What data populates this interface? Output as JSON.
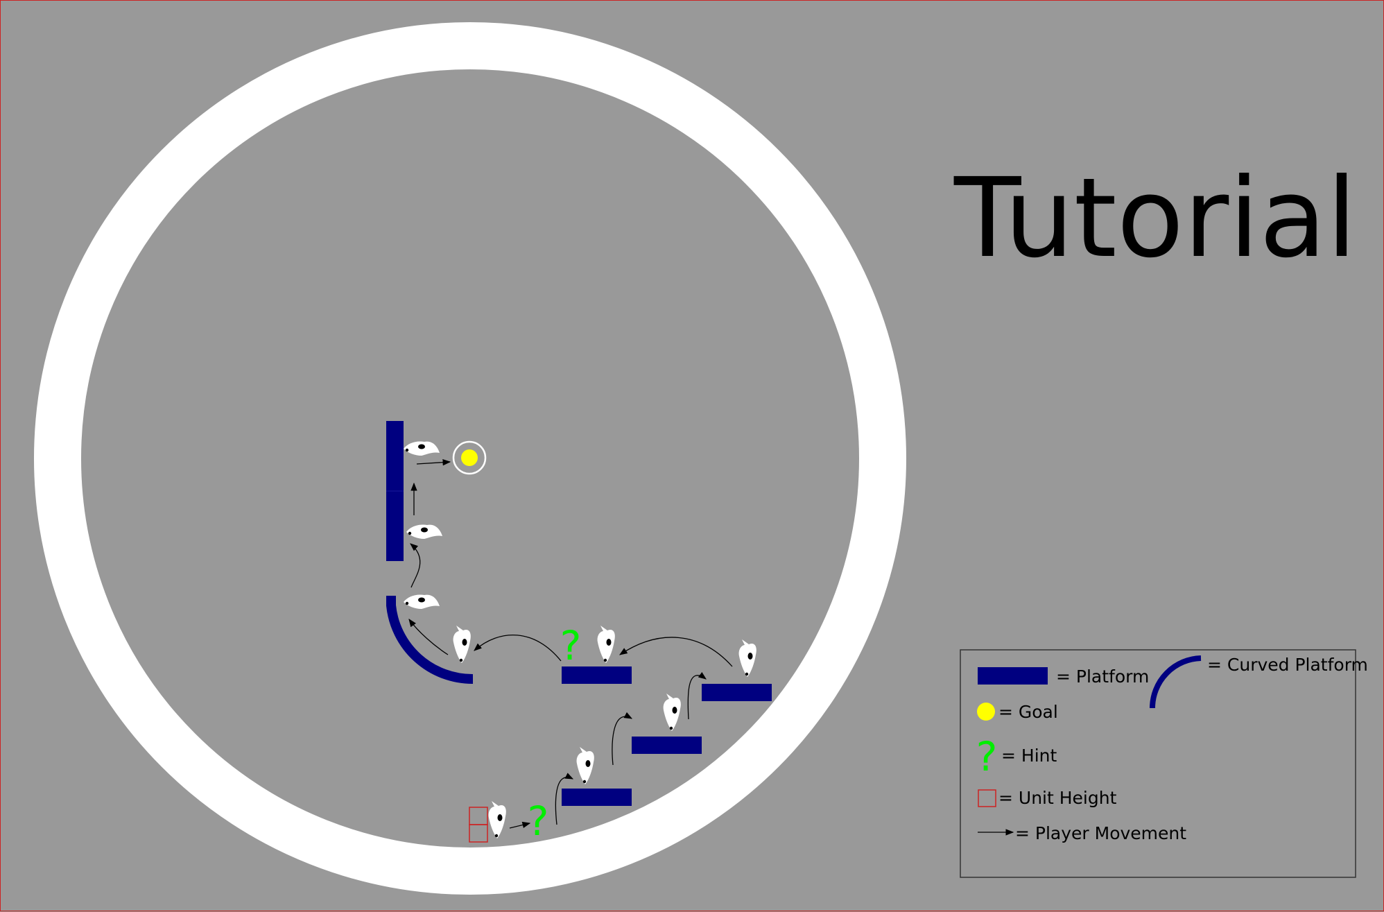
{
  "title": "Tutorial",
  "colors": {
    "background": "#999999",
    "ring": "#ffffff",
    "platform": "#000080",
    "goal": "#ffff00",
    "hint": "#00ee00",
    "unit_height": "#cc2222",
    "arrow": "#000000"
  },
  "icons": {
    "player": "player-creature-icon",
    "goal": "goal-icon",
    "hint": "hint-question-icon",
    "unit_height": "unit-height-box-icon",
    "movement": "arrow-icon"
  },
  "scene": {
    "hint_mark": "?"
  },
  "legend": {
    "platform": "= Platform",
    "curved_platform": "= Curved Platform",
    "goal": "= Goal",
    "hint": "= Hint",
    "hint_mark": "?",
    "unit_height": "= Unit Height",
    "player_movement": "= Player Movement"
  }
}
